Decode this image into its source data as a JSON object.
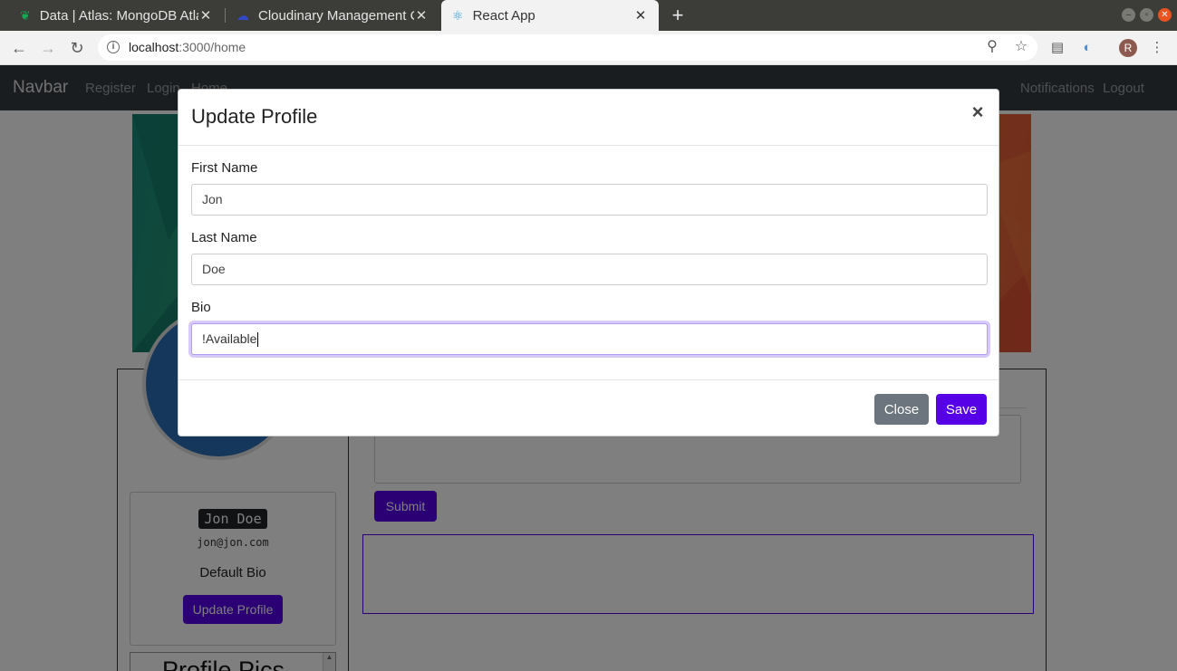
{
  "browser": {
    "tabs": [
      {
        "title": "Data | Atlas: MongoDB Atlas",
        "icon": "mongodb-leaf-icon",
        "active": false
      },
      {
        "title": "Cloudinary Management C",
        "icon": "cloudinary-icon",
        "active": false
      },
      {
        "title": "React App",
        "icon": "react-icon",
        "active": true
      }
    ],
    "url_host": "localhost",
    "url_path": ":3000/home",
    "profile_initial": "R"
  },
  "navbar": {
    "brand": "Navbar",
    "links": [
      "Register",
      "Login",
      "Home"
    ],
    "right_links": [
      "Notifications",
      "Logout"
    ]
  },
  "profile": {
    "name": "Jon Doe",
    "email": "jon@jon.com",
    "bio": "Default Bio",
    "update_button": "Update Profile",
    "pics_title": "Profile Pics",
    "submit_button": "Submit"
  },
  "modal": {
    "title": "Update Profile",
    "close_symbol": "×",
    "fields": [
      {
        "label": "First Name",
        "value": "Jon"
      },
      {
        "label": "Last Name",
        "value": "Doe"
      },
      {
        "label": "Bio",
        "value": "!Available"
      }
    ],
    "close_button": "Close",
    "save_button": "Save"
  },
  "colors": {
    "primary": "#5600e8",
    "secondary": "#6c757d",
    "navbar_bg": "#343a40"
  }
}
